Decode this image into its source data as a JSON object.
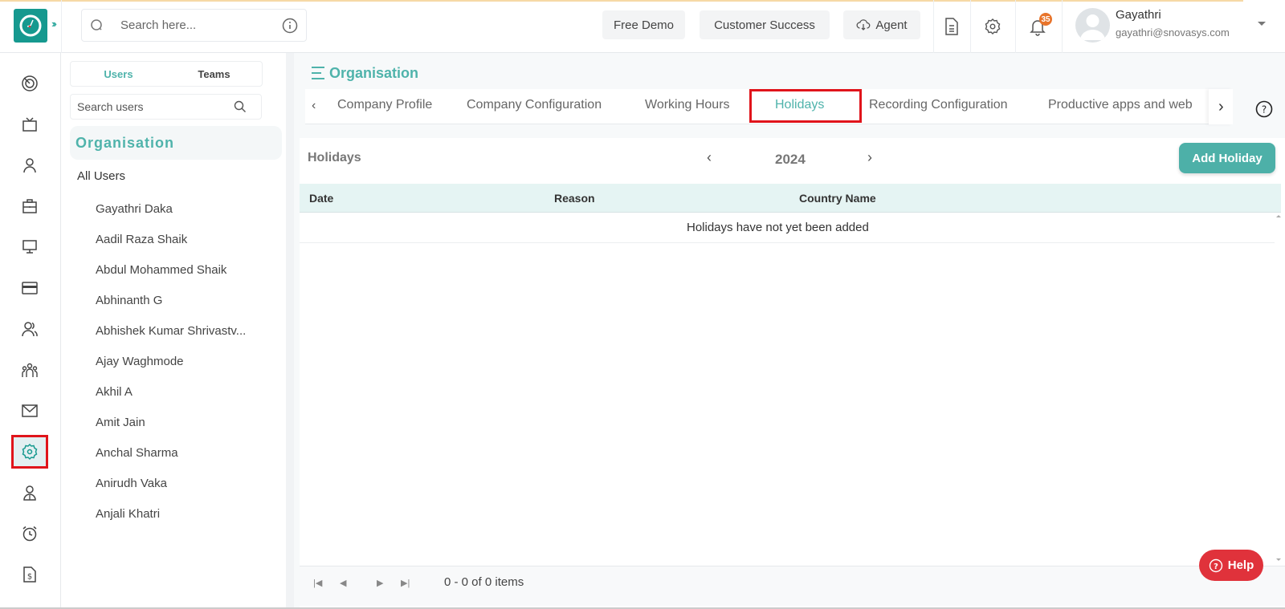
{
  "header": {
    "search_placeholder": "Search here...",
    "buttons": {
      "free_demo": "Free Demo",
      "customer_success": "Customer Success",
      "agent": "Agent"
    },
    "notification_count": "35",
    "user": {
      "name": "Gayathri",
      "email": "gayathri@snovasys.com"
    }
  },
  "rail": {
    "items": [
      {
        "icon": "dashboard-icon"
      },
      {
        "icon": "tv-icon"
      },
      {
        "icon": "user-icon"
      },
      {
        "icon": "briefcase-icon"
      },
      {
        "icon": "monitor-icon"
      },
      {
        "icon": "card-icon"
      },
      {
        "icon": "users-icon"
      },
      {
        "icon": "team-icon"
      },
      {
        "icon": "mail-icon"
      },
      {
        "icon": "settings-icon",
        "active": true
      },
      {
        "icon": "employee-icon"
      },
      {
        "icon": "alarm-icon"
      },
      {
        "icon": "invoice-icon"
      }
    ]
  },
  "users_panel": {
    "tabs": {
      "users": "Users",
      "teams": "Teams"
    },
    "search_placeholder": "Search users",
    "org_title": "Organisation",
    "all_users": "All Users",
    "users": [
      "Gayathri Daka",
      "Aadil Raza Shaik",
      "Abdul Mohammed Shaik",
      "Abhinanth G",
      "Abhishek Kumar Shrivastv...",
      "Ajay Waghmode",
      "Akhil A",
      "Amit Jain",
      "Anchal Sharma",
      "Anirudh Vaka",
      "Anjali Khatri"
    ]
  },
  "main": {
    "page_title": "Organisation",
    "tabs": [
      {
        "label": "Company Profile"
      },
      {
        "label": "Company Configuration"
      },
      {
        "label": "Working Hours"
      },
      {
        "label": "Holidays",
        "active": true
      },
      {
        "label": "Recording Configuration"
      },
      {
        "label": "Productive apps and web"
      }
    ],
    "section_title": "Holidays",
    "year": "2024",
    "add_button": "Add Holiday",
    "table": {
      "columns": [
        "Date",
        "Reason",
        "Country Name"
      ],
      "empty_message": "Holidays have not yet been added"
    },
    "pagination": {
      "info": "0 - 0 of 0 items"
    },
    "help_label": "Help"
  },
  "colors": {
    "accent": "#4fb3ab",
    "logo": "#16998f",
    "highlight": "#e0141b",
    "help": "#e0323b",
    "badge": "#e8742b"
  }
}
